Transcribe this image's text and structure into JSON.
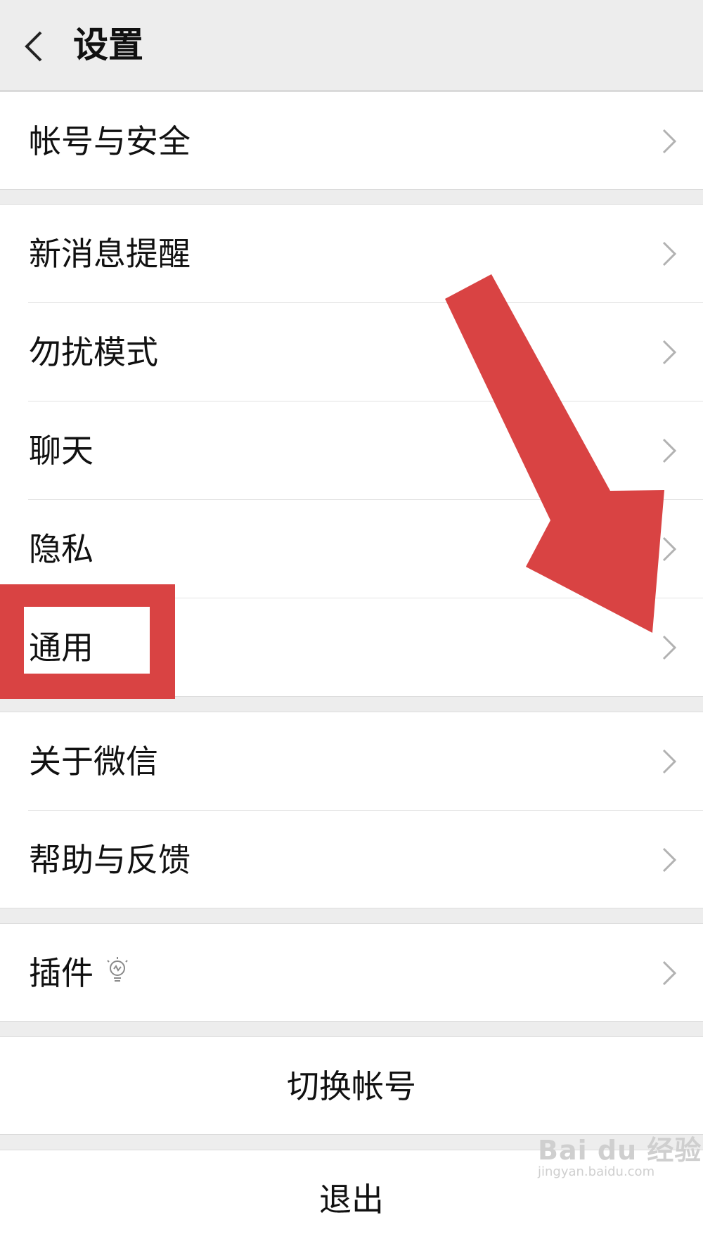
{
  "header": {
    "title": "设置"
  },
  "groups": {
    "account": {
      "items": [
        {
          "label": "帐号与安全"
        }
      ]
    },
    "main": {
      "items": [
        {
          "label": "新消息提醒"
        },
        {
          "label": "勿扰模式"
        },
        {
          "label": "聊天"
        },
        {
          "label": "隐私"
        },
        {
          "label": "通用"
        }
      ]
    },
    "about": {
      "items": [
        {
          "label": "关于微信"
        },
        {
          "label": "帮助与反馈"
        }
      ]
    },
    "plugins": {
      "items": [
        {
          "label": "插件",
          "icon": "lightbulb-icon"
        }
      ]
    }
  },
  "actions": {
    "switch_account": "切换帐号",
    "logout": "退出"
  },
  "annotation": {
    "color": "#d94343",
    "highlighted_item": "通用"
  },
  "watermark": {
    "brand": "Bai du 经验",
    "url": "jingyan.baidu.com"
  }
}
